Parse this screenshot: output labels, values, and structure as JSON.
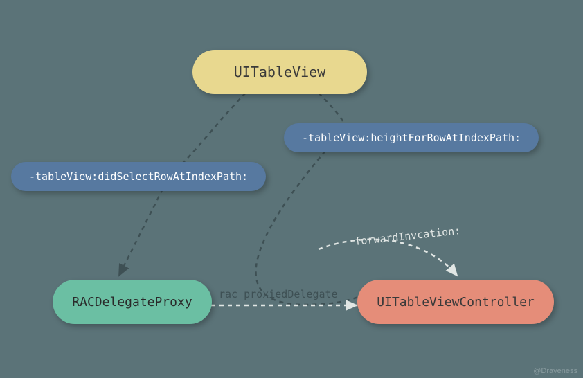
{
  "nodes": {
    "tableview": {
      "label": "UITableView"
    },
    "height": {
      "label": "-tableView:heightForRowAtIndexPath:"
    },
    "select": {
      "label": "-tableView:didSelectRowAtIndexPath:"
    },
    "proxy": {
      "label": "RACDelegateProxy"
    },
    "controller": {
      "label": "UITableViewController"
    }
  },
  "edges": {
    "rac_proxied": {
      "label": "rac_proxiedDelegate"
    },
    "forward": {
      "label": "forwardInvcation:"
    }
  },
  "attribution": "@Draveness"
}
